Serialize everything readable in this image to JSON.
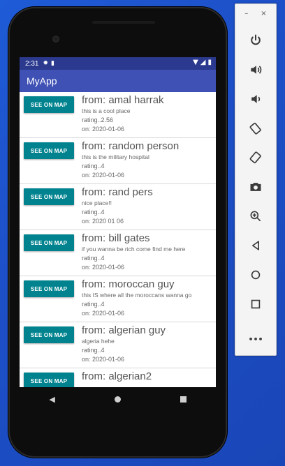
{
  "statusbar": {
    "time": "2:31"
  },
  "appbar": {
    "title": "MyApp"
  },
  "items": [
    {
      "button": "SEE ON MAP",
      "from": "from: amal harrak",
      "desc": "this is a cool place",
      "rating": "rating..2.56",
      "date": "on: 2020-01-06"
    },
    {
      "button": "SEE ON MAP",
      "from": "from: random person",
      "desc": "this is the military hospital",
      "rating": "rating..4",
      "date": "on: 2020-01-06"
    },
    {
      "button": "SEE ON MAP",
      "from": "from: rand pers",
      "desc": "nice place!!",
      "rating": "rating..4",
      "date": "on: 2020 01 06"
    },
    {
      "button": "SEE ON MAP",
      "from": "from: bill gates",
      "desc": "if you wanna be rich come find me here",
      "rating": "rating..4",
      "date": "on: 2020-01-06"
    },
    {
      "button": "SEE ON MAP",
      "from": "from: moroccan guy",
      "desc": "this IS where all the moroccans wanna go",
      "rating": "rating..4",
      "date": "on: 2020-01-06"
    },
    {
      "button": "SEE ON MAP",
      "from": "from: algerian guy",
      "desc": "algeria hehe",
      "rating": "rating..4",
      "date": "on: 2020-01-06"
    },
    {
      "button": "SEE ON MAP",
      "from": "from: algerian2",
      "desc": "",
      "rating": "",
      "date": ""
    }
  ],
  "panel": {
    "minimize_label": "–",
    "close_label": "×",
    "tools": [
      "power-icon",
      "volume-up-icon",
      "volume-down-icon",
      "rotate-left-icon",
      "rotate-right-icon",
      "camera-icon",
      "zoom-icon",
      "back-icon",
      "home-icon",
      "overview-icon",
      "more-icon"
    ],
    "more_label": "•••"
  },
  "colors": {
    "statusbar": "#2b3a8f",
    "appbar": "#3f51b5",
    "button": "#00838f"
  }
}
